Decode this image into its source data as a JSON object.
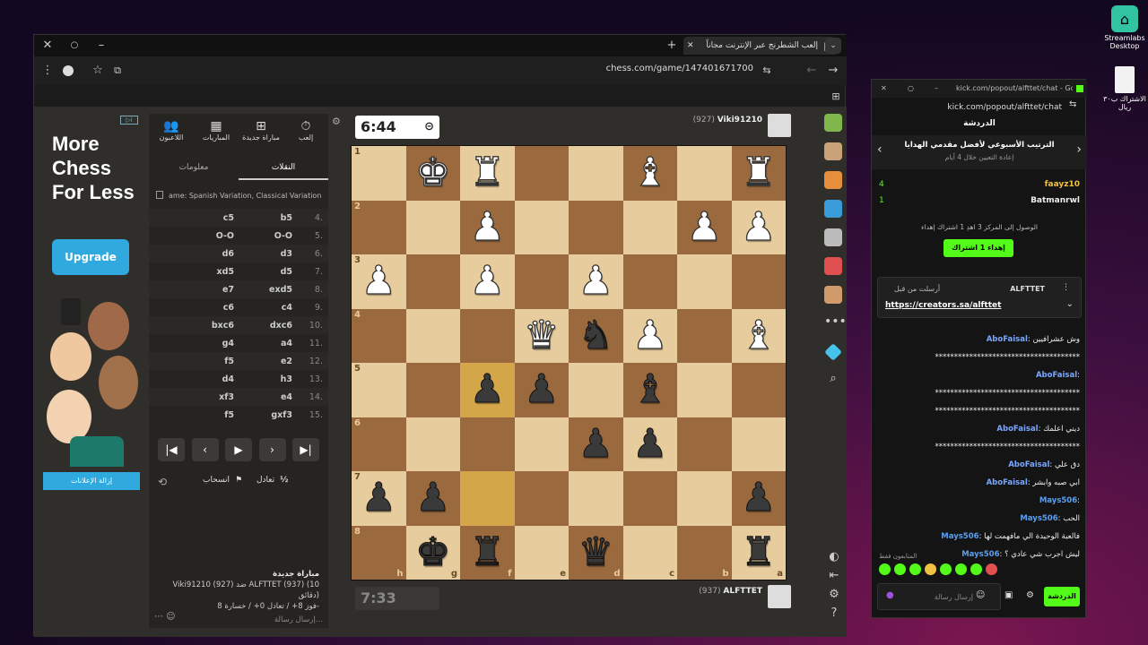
{
  "desktop": {
    "streamlabs": "Streamlabs Desktop",
    "file": "الاشتراك ب٣٠ ريال"
  },
  "browser": {
    "tab_title": "إلعب الشطرنج عبر الإنترنت مجاناً",
    "url": "chess.com/game/147401671700"
  },
  "ad": {
    "headline": "More Chess For Less",
    "upgrade": "Upgrade",
    "remove_ads": "إزالة الإعلانات"
  },
  "panel": {
    "nav": [
      {
        "label": "إلعب",
        "icon": "clock-icon"
      },
      {
        "label": "مباراة جديدة",
        "icon": "plus-icon"
      },
      {
        "label": "المباريات",
        "icon": "grid-icon"
      },
      {
        "label": "اللاعبون",
        "icon": "people-icon"
      }
    ],
    "tabs": {
      "moves": "النقلات",
      "info": "معلومات"
    },
    "opening": "ame: Spanish Variation, Classical Variation",
    "moves": [
      {
        "n": "4.",
        "w": "b5",
        "b": "c5"
      },
      {
        "n": "5.",
        "w": "O-O",
        "b": "O-O"
      },
      {
        "n": "6.",
        "w": "d3",
        "b": "d6"
      },
      {
        "n": "7.",
        "w": "d5",
        "b": "xd5"
      },
      {
        "n": "8.",
        "w": "exd5",
        "b": "e7"
      },
      {
        "n": "9.",
        "w": "c4",
        "b": "c6"
      },
      {
        "n": "10.",
        "w": "dxc6",
        "b": "bxc6"
      },
      {
        "n": "11.",
        "w": "a4",
        "b": "g4"
      },
      {
        "n": "12.",
        "w": "e2",
        "b": "f5"
      },
      {
        "n": "13.",
        "w": "h3",
        "b": "d4"
      },
      {
        "n": "14.",
        "w": "e4",
        "b": "xf3"
      },
      {
        "n": "15.",
        "w": "gxf3",
        "b": "f5"
      }
    ],
    "draw": "تعادل",
    "resign": "انسحاب",
    "half": "½",
    "new_game": "مباراة جديدة",
    "game_line": "Viki91210 (927) ضد ALFTTET (937) (10 دقائق)",
    "stats_line": "فوز 8+ / تعادل 0+ / خسارة 8-",
    "chat_placeholder": "إرسال رسالة..."
  },
  "game": {
    "top_clock": "6:44",
    "bottom_clock": "7:33",
    "top_player": "Viki91210",
    "top_rating": "(927)",
    "bottom_player": "ALFTTET",
    "bottom_rating": "(937)",
    "files": [
      "h",
      "g",
      "f",
      "e",
      "d",
      "c",
      "b",
      "a"
    ]
  },
  "kick": {
    "url_title": "kick.com/popout/alfttet/chat - Goo...",
    "url": "kick.com/popout/alfttet/chat",
    "header": "الدردشة",
    "giveaway_title": "الترتيب الأسبوعي لأفضل مقدمي الهدايا",
    "giveaway_sub": "إعادة التعيين خلال 4 أيام",
    "leader1": "faayz10",
    "leader1_count": "4",
    "leader2": "Batmanrwl",
    "leader2_count": "1",
    "reach": "الوصول إلى المركز 3 اهدِ 1 اشتراك إهداء",
    "gift_btn": "إهداء 1 اشتراك",
    "pinned_user": "ALFTTET",
    "pinned_label": "أرسلت من قبل",
    "pinned_link": "https://creators.sa/alfttet",
    "messages": [
      {
        "u": "AboFaisal",
        "t": "وش عشرافيين"
      },
      {
        "u": "",
        "t": "**************************************"
      },
      {
        "u": "AboFaisal",
        "t": ""
      },
      {
        "u": "",
        "t": "**************************************"
      },
      {
        "u": "",
        "t": "**************************************"
      },
      {
        "u": "AboFaisal",
        "t": "ديني اعلمك"
      },
      {
        "u": "",
        "t": "**************************************"
      },
      {
        "u": "AboFaisal",
        "t": "دق علي"
      },
      {
        "u": "AboFaisal",
        "t": "ابي صبه وابشر"
      },
      {
        "u": "Mays506",
        "t": ""
      },
      {
        "u": "Mays506",
        "t": "الحب"
      },
      {
        "u": "Mays506",
        "t": "فالعبة الوحيدة الي مافهمت لها"
      },
      {
        "u": "Mays506",
        "t": "ليش اجرب شي عادي ؟"
      }
    ],
    "followers": "المتابعون فقط",
    "send_placeholder": "إرسال رسالة",
    "chat_btn": "الدردشة"
  }
}
